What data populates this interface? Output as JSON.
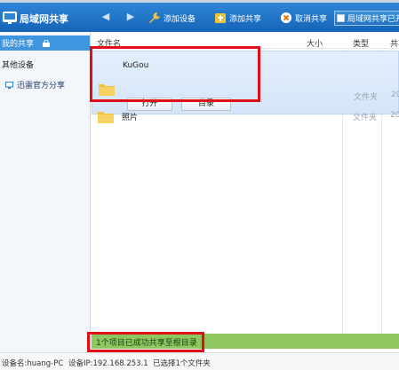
{
  "app": {
    "title": "局域网共享",
    "share_status": "局域网共享已开启"
  },
  "toolbar": {
    "back": "◀",
    "forward": "▶",
    "add_device": "添加设备",
    "add_share": "添加共享",
    "cancel_share": "取消共享"
  },
  "sidebar": {
    "my_share": "我的共享",
    "other_devices": "其他设备",
    "items": [
      {
        "label": "迅雷官方分享"
      }
    ]
  },
  "columns": {
    "name": "文件名",
    "size": "大小",
    "type": "类型",
    "shared": "共享"
  },
  "files": [
    {
      "name": "KuGou",
      "type": "文件夹",
      "date": "20"
    },
    {
      "name": "照片",
      "type": "文件夹",
      "date": "20"
    }
  ],
  "row_actions": {
    "open": "打开",
    "directory": "目录"
  },
  "status": {
    "message": "1个项目已成功共享至根目录"
  },
  "footer": {
    "device_name": "设备名:huang-PC",
    "device_ip": "设备IP:192.168.253.1",
    "selection": "已选择1个文件夹"
  },
  "colors": {
    "titlebar": "#1e74c8",
    "sidebar_active": "#3f95de",
    "status_green": "#8ec760",
    "highlight": "#e10d17",
    "folder": "#f2c23a"
  }
}
